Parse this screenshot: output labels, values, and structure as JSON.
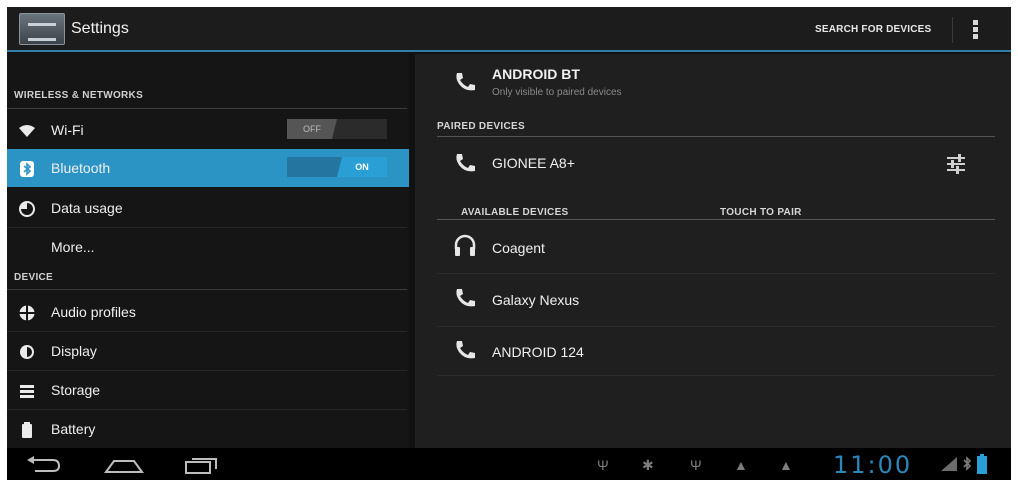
{
  "actionbar": {
    "title": "Settings",
    "search_label": "SEARCH FOR DEVICES"
  },
  "left": {
    "section_wireless": "WIRELESS & NETWORKS",
    "section_device": "DEVICE",
    "items": [
      {
        "label": "Wi-Fi",
        "icon": "wifi-icon",
        "toggle": "OFF"
      },
      {
        "label": "Bluetooth",
        "icon": "bluetooth-icon",
        "toggle": "ON",
        "selected": true
      },
      {
        "label": "Data usage",
        "icon": "data-usage-icon"
      },
      {
        "label": "More..."
      },
      {
        "label": "Audio profiles",
        "icon": "audio-profiles-icon"
      },
      {
        "label": "Display",
        "icon": "display-icon"
      },
      {
        "label": "Storage",
        "icon": "storage-icon"
      },
      {
        "label": "Battery",
        "icon": "battery-icon"
      }
    ]
  },
  "right": {
    "device_name": "ANDROID BT",
    "device_sub": "Only visible to paired devices",
    "paired_header": "PAIRED DEVICES",
    "paired": [
      {
        "label": "GIONEE A8+",
        "icon": "phone-icon"
      }
    ],
    "available_header": "AVAILABLE DEVICES",
    "touch_to_pair": "TOUCH TO PAIR",
    "available": [
      {
        "label": "Coagent",
        "icon": "headset-icon"
      },
      {
        "label": "Galaxy Nexus",
        "icon": "phone-icon"
      },
      {
        "label": "ANDROID 124",
        "icon": "phone-icon"
      }
    ]
  },
  "navbar": {
    "time": "11:00"
  },
  "colors": {
    "accent": "#2c94c4",
    "clock": "#2a87b8"
  }
}
